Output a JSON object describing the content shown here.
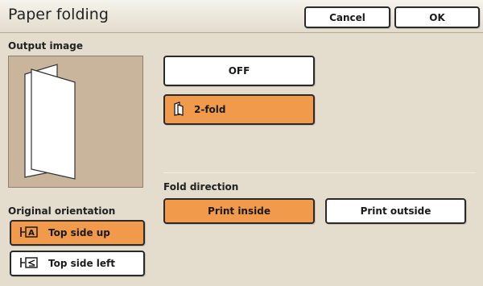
{
  "window": {
    "title": "Paper folding"
  },
  "header": {
    "cancel_label": "Cancel",
    "ok_label": "OK"
  },
  "output_image": {
    "label": "Output image"
  },
  "fold_mode": {
    "options": [
      {
        "label": "OFF",
        "selected": false
      },
      {
        "label": "2-fold",
        "selected": true,
        "icon": "two-fold-paper-icon"
      }
    ]
  },
  "fold_direction": {
    "label": "Fold direction",
    "options": [
      {
        "label": "Print inside",
        "selected": true
      },
      {
        "label": "Print outside",
        "selected": false
      }
    ]
  },
  "original_orientation": {
    "label": "Original orientation",
    "options": [
      {
        "label": "Top side up",
        "selected": true,
        "icon": "top-side-up-icon"
      },
      {
        "label": "Top side left",
        "selected": false,
        "icon": "top-side-left-icon"
      }
    ]
  },
  "colors": {
    "accent": "#f29a4b",
    "panel_background": "#e4dccd",
    "preview_background": "#c8b59c",
    "button_background": "#ffffff",
    "button_border": "#2a2a2a"
  }
}
